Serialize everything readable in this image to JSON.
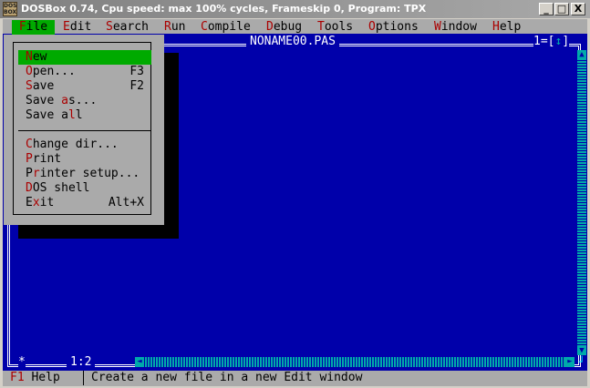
{
  "window": {
    "title": "DOSBox 0.74, Cpu speed: max 100% cycles, Frameskip  0, Program:     TPX",
    "icon_name": "dosbox-icon",
    "icon_text": "DOS BOX",
    "minimize": "_",
    "maximize": "□",
    "close": "X"
  },
  "menubar": [
    {
      "hk": "F",
      "rest": "ile"
    },
    {
      "hk": "E",
      "rest": "dit"
    },
    {
      "hk": "S",
      "rest": "earch"
    },
    {
      "hk": "R",
      "rest": "un"
    },
    {
      "hk": "C",
      "rest": "ompile"
    },
    {
      "hk": "D",
      "rest": "ebug"
    },
    {
      "hk": "T",
      "rest": "ools"
    },
    {
      "hk": "O",
      "rest": "ptions"
    },
    {
      "hk": "W",
      "rest": "indow"
    },
    {
      "hk": "H",
      "rest": "elp"
    }
  ],
  "editor": {
    "filename": "NONAME00.PAS",
    "window_number": "1=[",
    "resize_glyph": "↕",
    "close_bracket": "]",
    "cursor_position": "1:2",
    "corner_marker": "*"
  },
  "file_menu": {
    "items": [
      {
        "pre": "",
        "hk": "N",
        "post": "ew",
        "shortcut": ""
      },
      {
        "pre": "",
        "hk": "O",
        "post": "pen...",
        "shortcut": "F3"
      },
      {
        "pre": "",
        "hk": "S",
        "post": "ave",
        "shortcut": "F2"
      },
      {
        "pre": "Save ",
        "hk": "a",
        "post": "s...",
        "shortcut": ""
      },
      {
        "pre": "Save a",
        "hk": "l",
        "post": "l",
        "shortcut": ""
      },
      {
        "pre": "",
        "hk": "C",
        "post": "hange dir...",
        "shortcut": ""
      },
      {
        "pre": "",
        "hk": "P",
        "post": "rint",
        "shortcut": ""
      },
      {
        "pre": "P",
        "hk": "r",
        "post": "inter setup...",
        "shortcut": ""
      },
      {
        "pre": "",
        "hk": "D",
        "post": "OS shell",
        "shortcut": ""
      },
      {
        "pre": "E",
        "hk": "x",
        "post": "it",
        "shortcut": "Alt+X"
      }
    ]
  },
  "status": {
    "key": "F1",
    "key_label": " Help",
    "hint": "Create a new file in a new Edit window"
  },
  "colors": {
    "dos_blue": "#0000aa",
    "dos_gray": "#aaaaaa",
    "highlight_green": "#00aa00",
    "hotkey_red": "#aa0000",
    "scroll_cyan": "#00aaaa"
  }
}
